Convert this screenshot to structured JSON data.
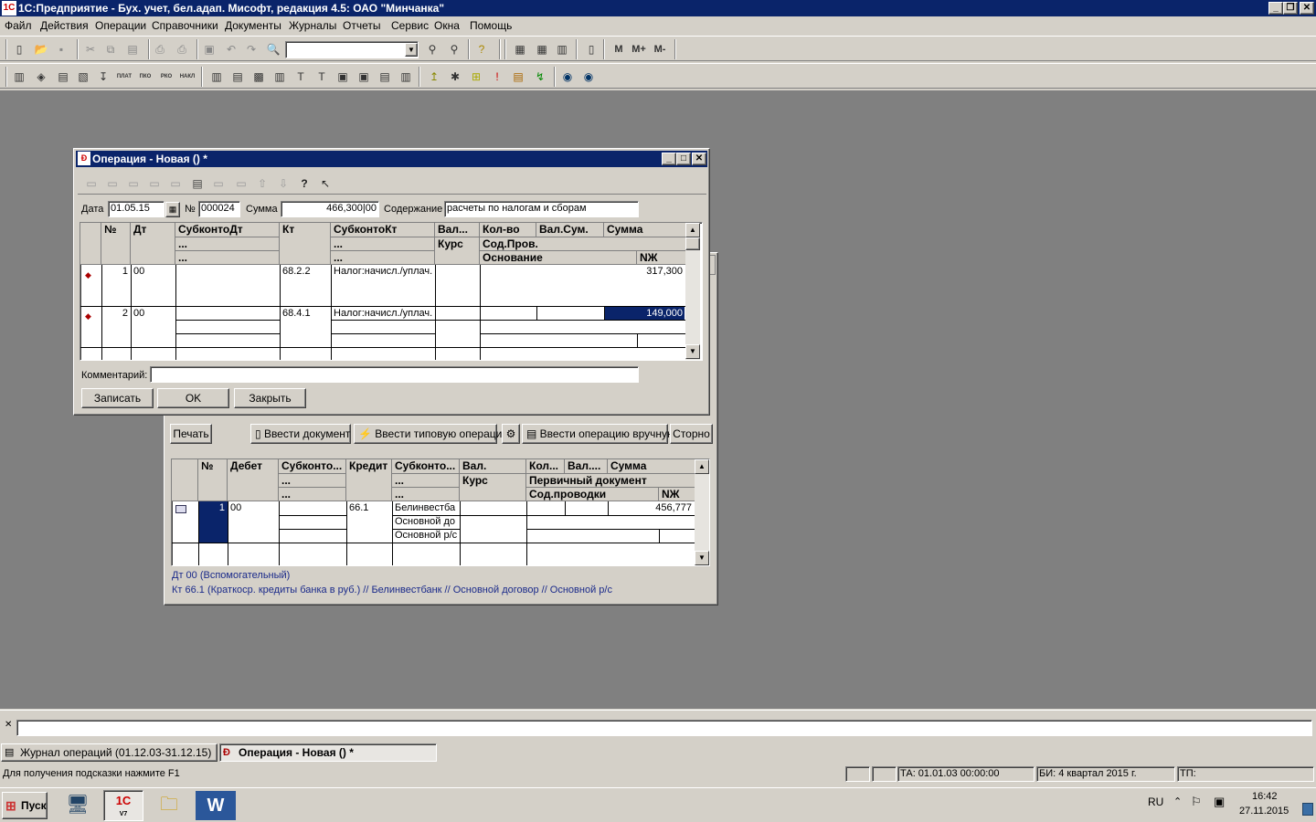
{
  "app": {
    "title": "1С:Предприятие - Бух. учет, бел.адап. Мисофт, редакция 4.5: ОАО \"Минчанка\""
  },
  "menu": [
    "Файл",
    "Действия",
    "Операции",
    "Справочники",
    "Документы",
    "Журналы",
    "Отчеты",
    "Сервис",
    "Окна",
    "Помощь"
  ],
  "toolbar": {
    "memory_buttons": [
      "M",
      "M+",
      "M-"
    ],
    "doc_labels": [
      "ПЛАТ",
      "ПКО",
      "РКО",
      "НАКЛ"
    ]
  },
  "dialog": {
    "title": "Операция - Новая () *",
    "date_label": "Дата",
    "date_value": "01.05.15",
    "num_label": "№",
    "num_value": "000024",
    "sum_label": "Сумма",
    "sum_value": "466,300|00",
    "content_label": "Содержание",
    "content_value": "расчеты по налогам и сборам",
    "headers": {
      "num": "№",
      "dt": "Дт",
      "subdt": "СубконтоДт",
      "subdt2": "...",
      "subdt3": "...",
      "kt": "Кт",
      "subkt": "СубконтоКт",
      "subkt2": "...",
      "subkt3": "...",
      "val": "Вал...",
      "kurs": "Курс",
      "kolvo": "Кол-во",
      "valsum": "Вал.Сум.",
      "summa": "Сумма",
      "sodprov": "Сод.Пров.",
      "osnovanie": "Основание",
      "nzh": "NЖ"
    },
    "rows": [
      {
        "num": "1",
        "dt": "00",
        "kt": "68.2.2",
        "subkt": "Налог:начисл./уплач.",
        "summa": "317,300"
      },
      {
        "num": "2",
        "dt": "00",
        "kt": "68.4.1",
        "subkt": "Налог:начисл./уплач.",
        "summa": "149,000"
      }
    ],
    "comment_label": "Комментарий:",
    "comment_value": "",
    "buttons": {
      "save": "Записать",
      "ok": "OK",
      "close": "Закрыть"
    }
  },
  "journal": {
    "buttons": {
      "print": "Печать",
      "enter_doc": "Ввести документ",
      "enter_typical": "Ввести типовую операцию",
      "enter_manual": "Ввести операцию вручную",
      "storno": "Сторно"
    },
    "headers": {
      "num": "№",
      "debet": "Дебет",
      "subkonto": "Субконто...",
      "sub2": "...",
      "sub3": "...",
      "kredit": "Кредит",
      "subkonto_k": "Субконто...",
      "subk2": "...",
      "subk3": "...",
      "val": "Вал.",
      "kurs": "Курс",
      "kolvo": "Кол...",
      "valsum": "Вал....",
      "summa": "Сумма",
      "pervdoc": "Первичный документ",
      "sodprov": "Сод.проводки",
      "nzh": "NЖ"
    },
    "row": {
      "num": "1",
      "debet": "00",
      "kredit": "66.1",
      "sub1": "Белинвестба",
      "sub2": "Основной до",
      "sub3": "Основной р/с",
      "summa": "456,777"
    },
    "info_line1": "Дт 00 (Вспомогательный)",
    "info_line2": "Кт 66.1 (Краткоср. кредиты банка в руб.) // Белинвестбанк // Основной договор // Основной р/с"
  },
  "window_tabs": [
    {
      "label": "Журнал операций  (01.12.03-31.12.15)"
    },
    {
      "label": "Операция - Новая () *"
    }
  ],
  "status": {
    "hint": "Для получения подсказки нажмите F1",
    "ta": "ТА: 01.01.03  00:00:00",
    "bi": "БИ: 4 квартал 2015 г.",
    "tp": "ТП:"
  },
  "taskbar": {
    "start": "Пуск",
    "lang": "RU",
    "time": "16:42",
    "date": "27.11.2015",
    "v7_label": "V7"
  },
  "colors": {
    "title_bar": "#0a246a",
    "selection": "#0a246a",
    "mdi_bg": "#808080",
    "info_text": "#1a2a8a"
  }
}
